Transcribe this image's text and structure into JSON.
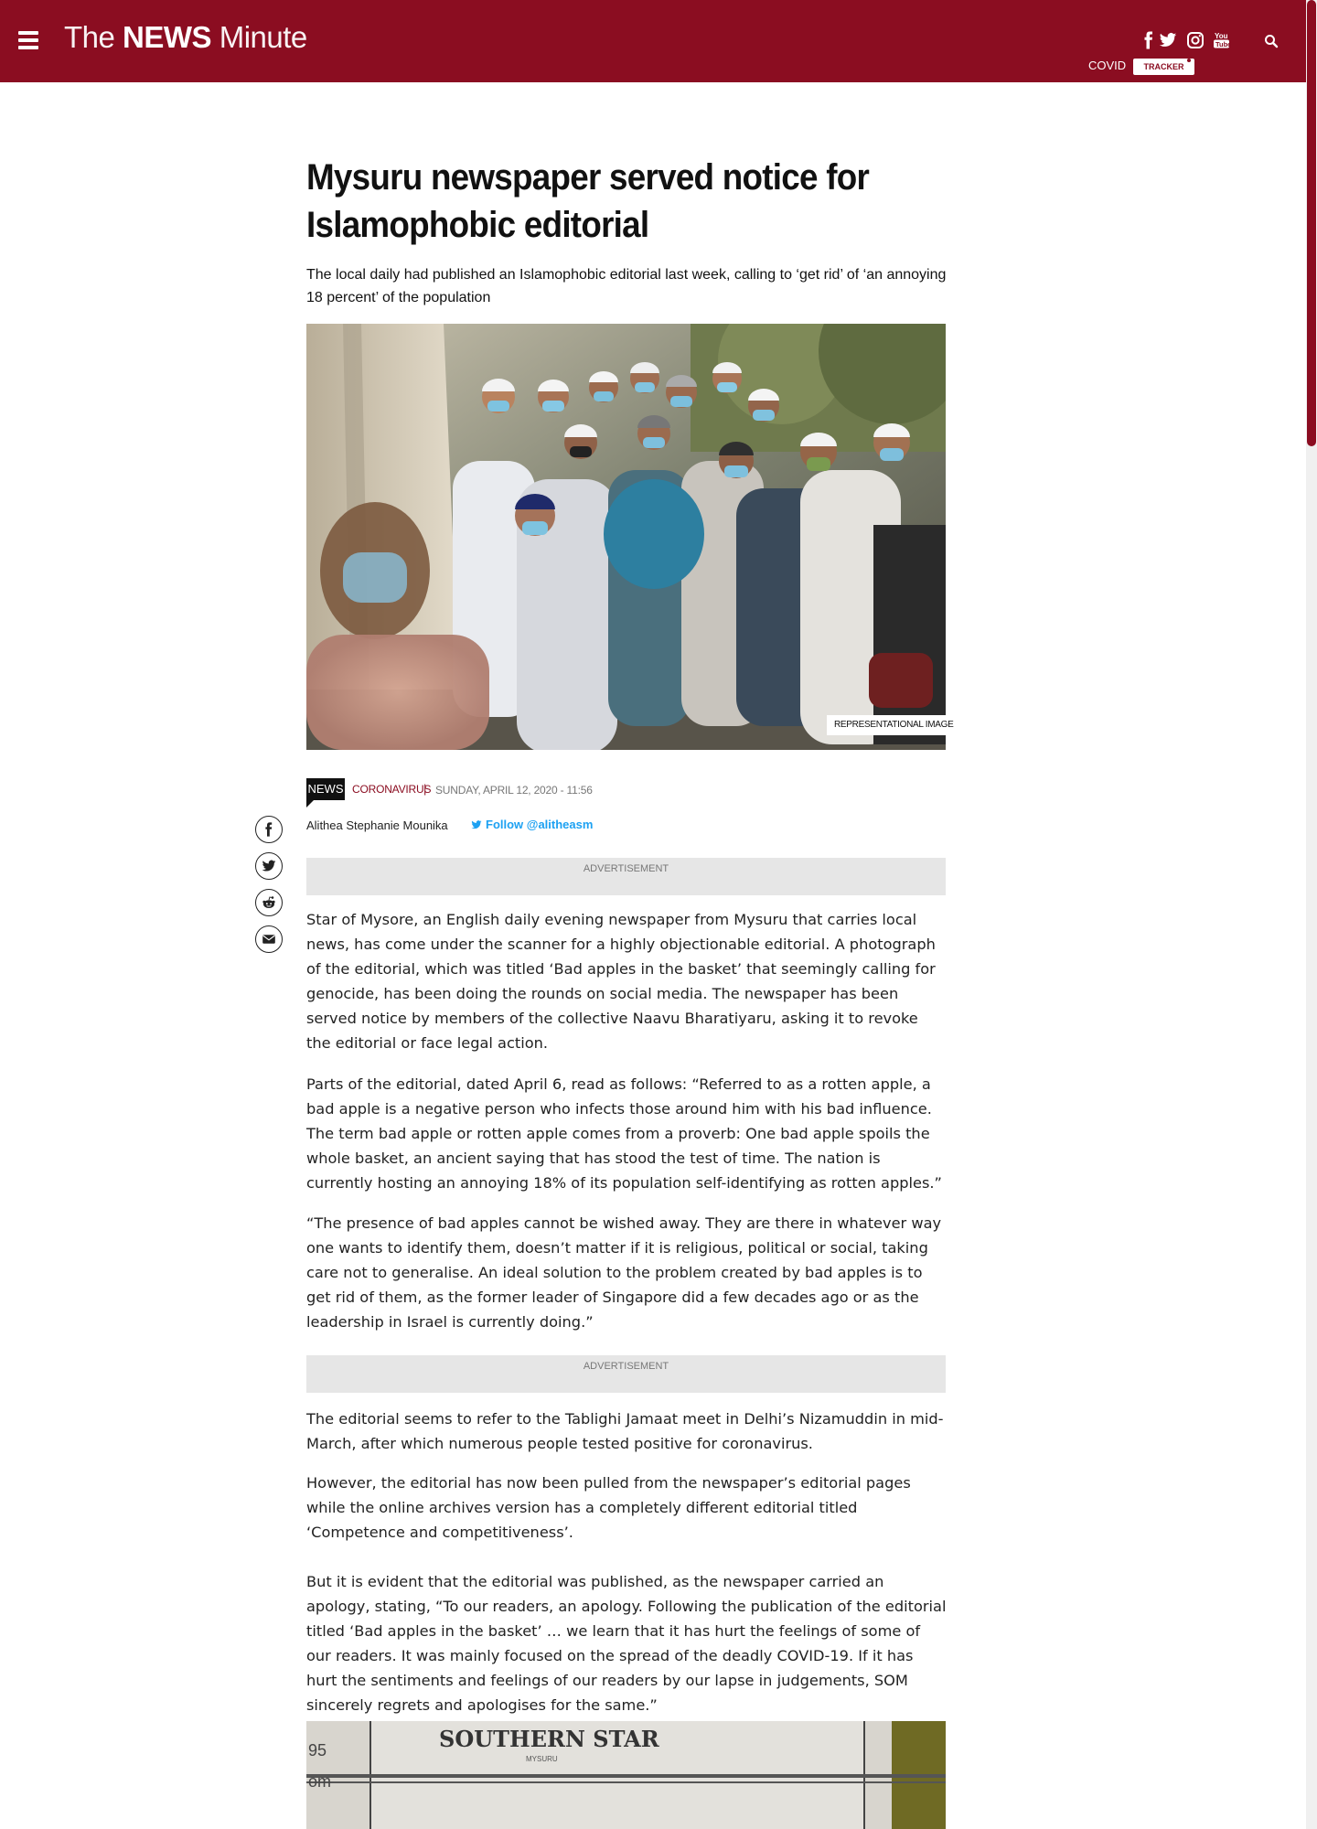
{
  "header": {
    "logo_the": "The",
    "logo_news": "NEWS",
    "logo_minute": "Minute",
    "covid_label": "COVID",
    "tracker_label": "TRACKER",
    "brand_color": "#8b0d21"
  },
  "article": {
    "title": "Mysuru newspaper served notice for Islamophobic editorial",
    "subtitle": "The local daily had published an Islamophobic editorial last week, calling to ‘get rid’ of ‘an annoying 18 percent’ of the population",
    "image_label": "REPRESENTATIONAL IMAGE",
    "section_tag": "NEWS",
    "category": "CORONAVIRUS",
    "separator": "|",
    "date": "SUNDAY, APRIL 12, 2020 - 11:56",
    "author": "Alithea Stephanie Mounika",
    "follow": "Follow @alitheasm",
    "ad_label_1": "ADVERTISEMENT",
    "ad_label_2": "ADVERTISEMENT",
    "paragraphs": [
      "Star of Mysore, an English daily evening newspaper from Mysuru that carries local news, has come under the scanner for a highly objectionable editorial. A photograph of the editorial, which was titled ‘Bad apples in the basket’ that seemingly calling for genocide, has been doing the rounds on social media. The newspaper has been served notice by members of the collective Naavu Bharatiyaru, asking it to revoke the editorial or face legal action.",
      "Parts of the editorial, dated April 6, read as follows: “Referred to as a rotten apple, a bad apple is a negative person who infects those around him with his bad influence. The term bad apple or rotten apple comes from a proverb: One bad apple spoils the whole basket, an ancient saying that has stood the test of time. The nation is currently hosting an annoying 18% of its population self-identifying as rotten apples.”",
      "“The presence of bad apples cannot be wished away. They are there in whatever way one wants to identify them, doesn’t matter if it is religious, political or social, taking care not to generalise. An ideal solution to the problem created by bad apples is to get rid of them, as the former leader of Singapore did a few decades ago or as the leadership in Israel is currently doing.”",
      "The editorial seems to refer to the Tablighi Jamaat meet in Delhi’s Nizamuddin in mid-March, after which numerous people tested positive for coronavirus.",
      "However, the editorial has now been pulled from the newspaper’s editorial pages while the online archives version has a completely different editorial titled ‘Competence and competitiveness’.",
      "But it is evident that the editorial was published, as the newspaper carried an apology, stating, “To our readers, an apology. Following the publication of the editorial titled ‘Bad apples in the basket’ … we learn that it has hurt the feelings of some of our readers. It was mainly focused on the spread of the deadly COVID-19. If it has hurt the sentiments and feelings of our readers by our lapse in judgements, SOM sincerely regrets and apologises for the same.”"
    ],
    "bottom_image_text": {
      "masthead": "SOUTHERN STAR",
      "city": "MYSURU",
      "left_1": "95",
      "left_2": "om"
    }
  },
  "icons": [
    "menu-icon",
    "facebook-icon",
    "twitter-icon",
    "instagram-icon",
    "youtube-icon",
    "search-icon",
    "twitter-bird-icon",
    "reddit-icon",
    "email-icon"
  ]
}
